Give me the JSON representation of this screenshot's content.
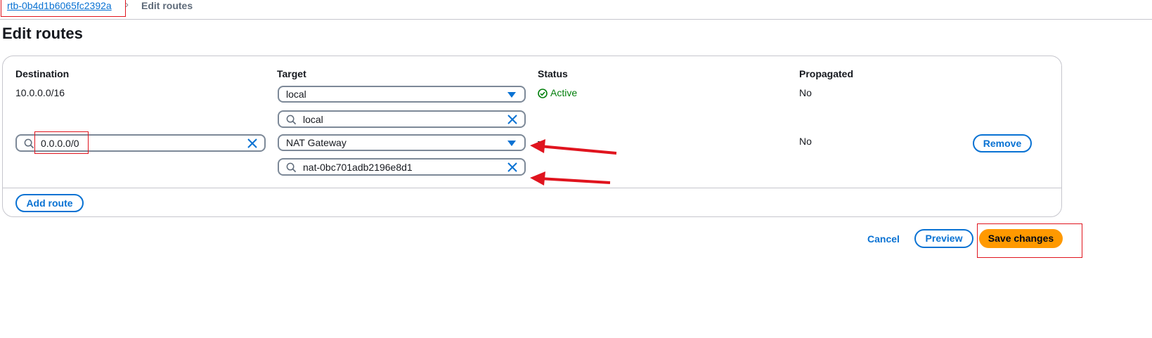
{
  "breadcrumb": {
    "parent": "rtb-0b4d1b6065fc2392a",
    "separator": "›",
    "current": "Edit routes"
  },
  "page": {
    "title": "Edit routes"
  },
  "table": {
    "columns": [
      "Destination",
      "Target",
      "Status",
      "Propagated"
    ],
    "rows": [
      {
        "destination": "10.0.0.0/16",
        "target_type": "local",
        "target_search": "local",
        "status": "Active",
        "propagated": "No"
      },
      {
        "destination": "0.0.0.0/0",
        "target_type": "NAT Gateway",
        "target_search": "nat-0bc701adb2196e8d1",
        "status": "–",
        "propagated": "No",
        "remove_label": "Remove"
      }
    ]
  },
  "actions": {
    "add_route": "Add route",
    "cancel": "Cancel",
    "preview": "Preview",
    "save": "Save changes"
  },
  "colors": {
    "link": "#0972d3",
    "primary": "#ff9900",
    "success": "#037f0c",
    "annotation": "#e0141e"
  },
  "icons": [
    "chevron-right-icon",
    "caret-down-icon",
    "search-icon",
    "clear-icon",
    "status-success-icon",
    "arrow-annotation"
  ]
}
